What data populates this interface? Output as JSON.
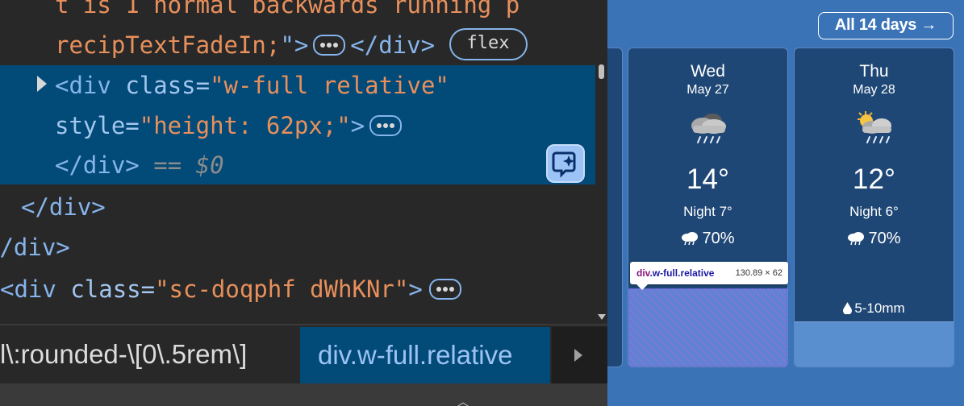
{
  "devtools": {
    "lines": {
      "l1": "t is 1 normal backwards running p",
      "l2_str": "recipTextFadeIn;",
      "l2_close": "\">",
      "l2_tag": "</div>",
      "l2_badge": "flex",
      "l3_open": "<div ",
      "l3_attr": "class=",
      "l3_val": "\"w-full relative\"",
      "l4_attr": "style=",
      "l4_val": "\"height: 62px;\"",
      "l4_close": ">",
      "l5_tag": "</div>",
      "l5_ref": " == $0",
      "l6_tag": "</div>",
      "l7_tag": "</div>",
      "l8_open": "<div ",
      "l8_attr": "class=",
      "l8_val": "\"sc-doqphf dWhKNr\"",
      "l8_close": ">"
    },
    "breadcrumbs": [
      "l\\:rounded-\\[0\\.5rem\\]",
      "div.w-full.relative"
    ],
    "icons": {
      "expand": "triangle-right-icon",
      "ai_assist": "ai-sparkle-icon",
      "breadcrumb_next": "triangle-right-icon"
    }
  },
  "weather": {
    "all_days_label": "All 14 days →",
    "days": [
      {
        "day": "Wed",
        "date": "May 27",
        "temp": "14°",
        "night": "Night 7°",
        "precip": "70%",
        "icon": "cloud-rain-icon"
      },
      {
        "day": "Thu",
        "date": "May 28",
        "temp": "12°",
        "night": "Night 6°",
        "precip": "70%",
        "rain": "5-10mm",
        "icon": "sun-cloud-rain-icon"
      }
    ]
  },
  "inspector_tooltip": {
    "tag": "div",
    "classes": ".w-full.relative",
    "size": "130.89 × 62"
  },
  "colors": {
    "devtools_bg": "#282828",
    "selection": "#024a78",
    "string": "#e8905c",
    "tag": "#86b4ec",
    "page_bg": "#3b73b7",
    "card_bg": "#1f4775"
  }
}
